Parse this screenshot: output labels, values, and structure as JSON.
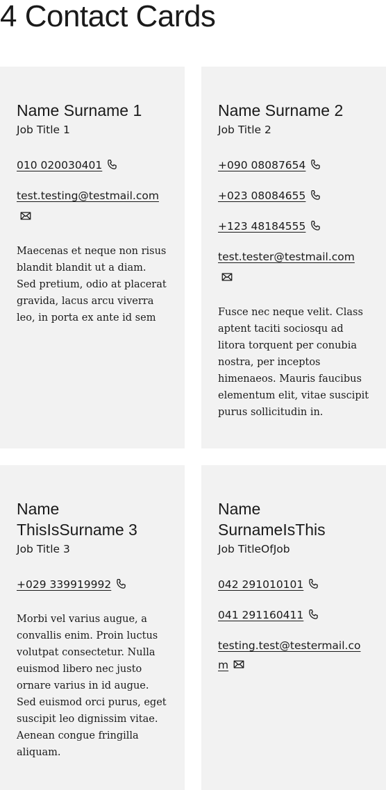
{
  "page": {
    "title": "4 Contact Cards"
  },
  "cards": [
    {
      "name": "Name Surname 1",
      "job_title": "Job Title 1",
      "phones": [
        "010 020030401"
      ],
      "email": "test.testing@testmail.com",
      "description": "Maecenas et neque non risus blandit blandit ut a diam. Sed pretium, odio at placerat gravida, lacus arcu viverra leo, in porta ex ante id sem"
    },
    {
      "name": "Name Surname 2",
      "job_title": "Job Title 2",
      "phones": [
        "+090 08087654",
        "+023 08084655",
        "+123 48184555"
      ],
      "email": "test.tester@testmail.com",
      "description": "Fusce nec neque velit. Class aptent taciti sociosqu ad litora torquent per conubia nostra, per inceptos himenaeos. Mauris faucibus elementum elit, vitae suscipit purus sollicitudin in."
    },
    {
      "name": "Name ThisIsSurname 3",
      "job_title": "Job Title 3",
      "phones": [
        "+029 339919992"
      ],
      "email": "",
      "description": "Morbi vel varius augue, a convallis enim. Proin luctus volutpat consectetur. Nulla euismod libero nec justo ornare varius in id augue. Sed euismod orci purus, eget suscipit leo dignissim vitae. Aenean congue fringilla aliquam."
    },
    {
      "name": "Name SurnameIsThis",
      "job_title": "Job TitleOfJob",
      "phones": [
        "042 291010101",
        "041 291160411"
      ],
      "email": "testing.test@testermail.com",
      "description": ""
    }
  ],
  "icons": {
    "phone": "phone-icon",
    "email": "mail-icon"
  },
  "colors": {
    "card_background": "#f2f2f2",
    "text": "#1a1a1a"
  }
}
